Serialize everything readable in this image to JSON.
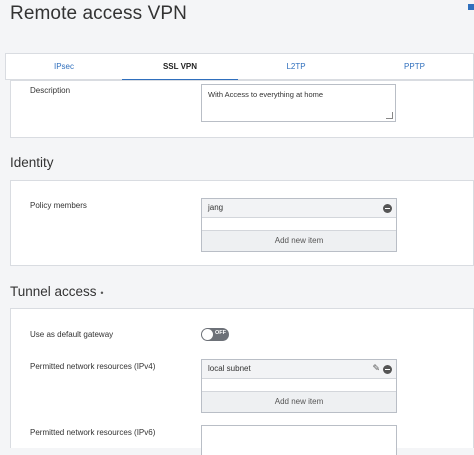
{
  "page": {
    "title": "Remote access VPN"
  },
  "tabs": [
    {
      "label": "IPsec",
      "active": false
    },
    {
      "label": "SSL VPN",
      "active": true
    },
    {
      "label": "L2TP",
      "active": false
    },
    {
      "label": "PPTP",
      "active": false
    }
  ],
  "general": {
    "description_label": "Description",
    "description_value": "With Access to everything at home"
  },
  "identity": {
    "heading": "Identity",
    "policy_members_label": "Policy members",
    "members": [
      "jang"
    ],
    "add_label": "Add new item"
  },
  "tunnel": {
    "heading": "Tunnel access",
    "required_marker": "•",
    "default_gateway_label": "Use as default gateway",
    "default_gateway_state": "OFF",
    "ipv4_label": "Permitted network resources (IPv4)",
    "ipv4_items": [
      "local subnet"
    ],
    "ipv4_add_label": "Add new item",
    "ipv6_label": "Permitted network resources (IPv6)"
  },
  "colors": {
    "accent": "#2f6fbd",
    "toggle_off": "#6d7178"
  },
  "icons": {
    "remove": "remove-circle-icon",
    "edit": "pencil-icon"
  }
}
